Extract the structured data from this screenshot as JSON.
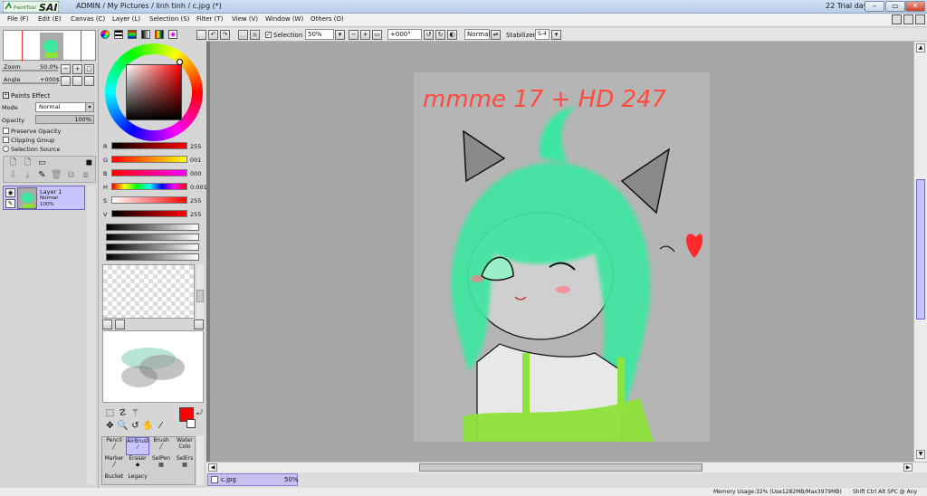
{
  "window": {
    "app_logo_text": "SAI",
    "app_logo_prefix": "PaintTool",
    "title": "ADMIN / My Pictures / linh tinh / c.jpg (*)",
    "trial": "22 Trial day",
    "min": "–",
    "max": "▭",
    "close": "✕"
  },
  "menu": {
    "file": "File (F)",
    "edit": "Edit (E)",
    "canvas": "Canvas (C)",
    "layer": "Layer (L)",
    "selection": "Selection (S)",
    "filter": "Filter (T)",
    "view": "View (V)",
    "window": "Window (W)",
    "others": "Others (O)"
  },
  "navigator": {
    "zoom_label": "Zoom",
    "zoom_value": "50.0%",
    "angle_label": "Angle",
    "angle_value": "+000$",
    "minus": "−",
    "plus": "+",
    "reset": "▢"
  },
  "layer_props": {
    "paints_effect": "Paints Effect",
    "mode_label": "Mode",
    "mode_value": "Normal",
    "opacity_label": "Opacity",
    "opacity_value": "100%",
    "opacity_level": 1.0,
    "preserve_opacity": "Preserve Opacity",
    "clipping_group": "Clipping Group",
    "selection_source": "Selection Source"
  },
  "layer": {
    "name": "Layer 1",
    "mode": "Normal",
    "opacity": "100%"
  },
  "color": {
    "r_label": "R",
    "r_value": "255",
    "g_label": "G",
    "g_value": "001",
    "b_label": "B",
    "b_value": "000",
    "h_label": "H",
    "h_value": "0:001",
    "s_label": "S",
    "s_value": "255",
    "v_label": "V",
    "v_value": "255",
    "current": "#ff0000",
    "secondary": "#ffffff"
  },
  "brushes": {
    "pencil": "Pencil",
    "airbrush": "AirBrush",
    "brush": "Brush",
    "water": "Water",
    "water2": "Colo",
    "marker": "Marker",
    "eraser": "Eraser",
    "selpen": "SelPen",
    "selers": "SelErs",
    "bucket": "Bucket",
    "legacy": "Legacy"
  },
  "toolbar": {
    "selection_label": "Selection",
    "zoom_value": "50%",
    "angle_value": "+000°",
    "blend_value": "Normal",
    "stabilizer_label": "Stabilizer",
    "stabilizer_value": "S-4"
  },
  "canvas": {
    "doodle_text": "mmme 17 + HD 247",
    "hair_color": "#3ee6a0",
    "sweater_color": "#8ee23a",
    "heart_color": "#ff2b2b"
  },
  "document": {
    "name": "c.jpg",
    "zoom": "50%"
  },
  "status": {
    "memory": "Memory Usage:32% (Use1282MB/Max3979MB)",
    "indicators": "Shift Ctrl Alt SPC @ Any"
  }
}
